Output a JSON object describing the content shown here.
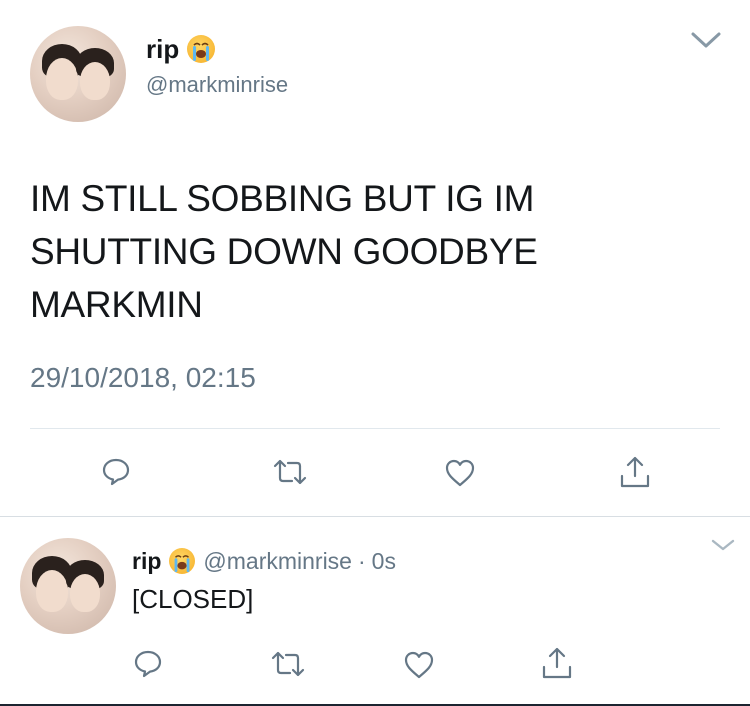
{
  "main_tweet": {
    "display_name": "rip",
    "name_emoji": "loudly-crying-face",
    "handle": "@markminrise",
    "text_line1": "IM STILL SOBBING BUT IG IM",
    "text_line2": "SHUTTING DOWN GOODBYE",
    "text_line3": "MARKMIN",
    "timestamp": "29/10/2018, 02:15",
    "actions": [
      "reply-icon",
      "retweet-icon",
      "like-icon",
      "share-icon"
    ]
  },
  "reply_tweet": {
    "display_name": "rip",
    "name_emoji": "loudly-crying-face",
    "handle": "@markminrise",
    "separator": "·",
    "age": "0s",
    "text": "[CLOSED]",
    "actions": [
      "reply-icon",
      "retweet-icon",
      "like-icon",
      "share-icon"
    ]
  },
  "colors": {
    "text": "#14171a",
    "secondary": "#657786",
    "icon": "#657786",
    "divider": "#e1e8ed"
  }
}
